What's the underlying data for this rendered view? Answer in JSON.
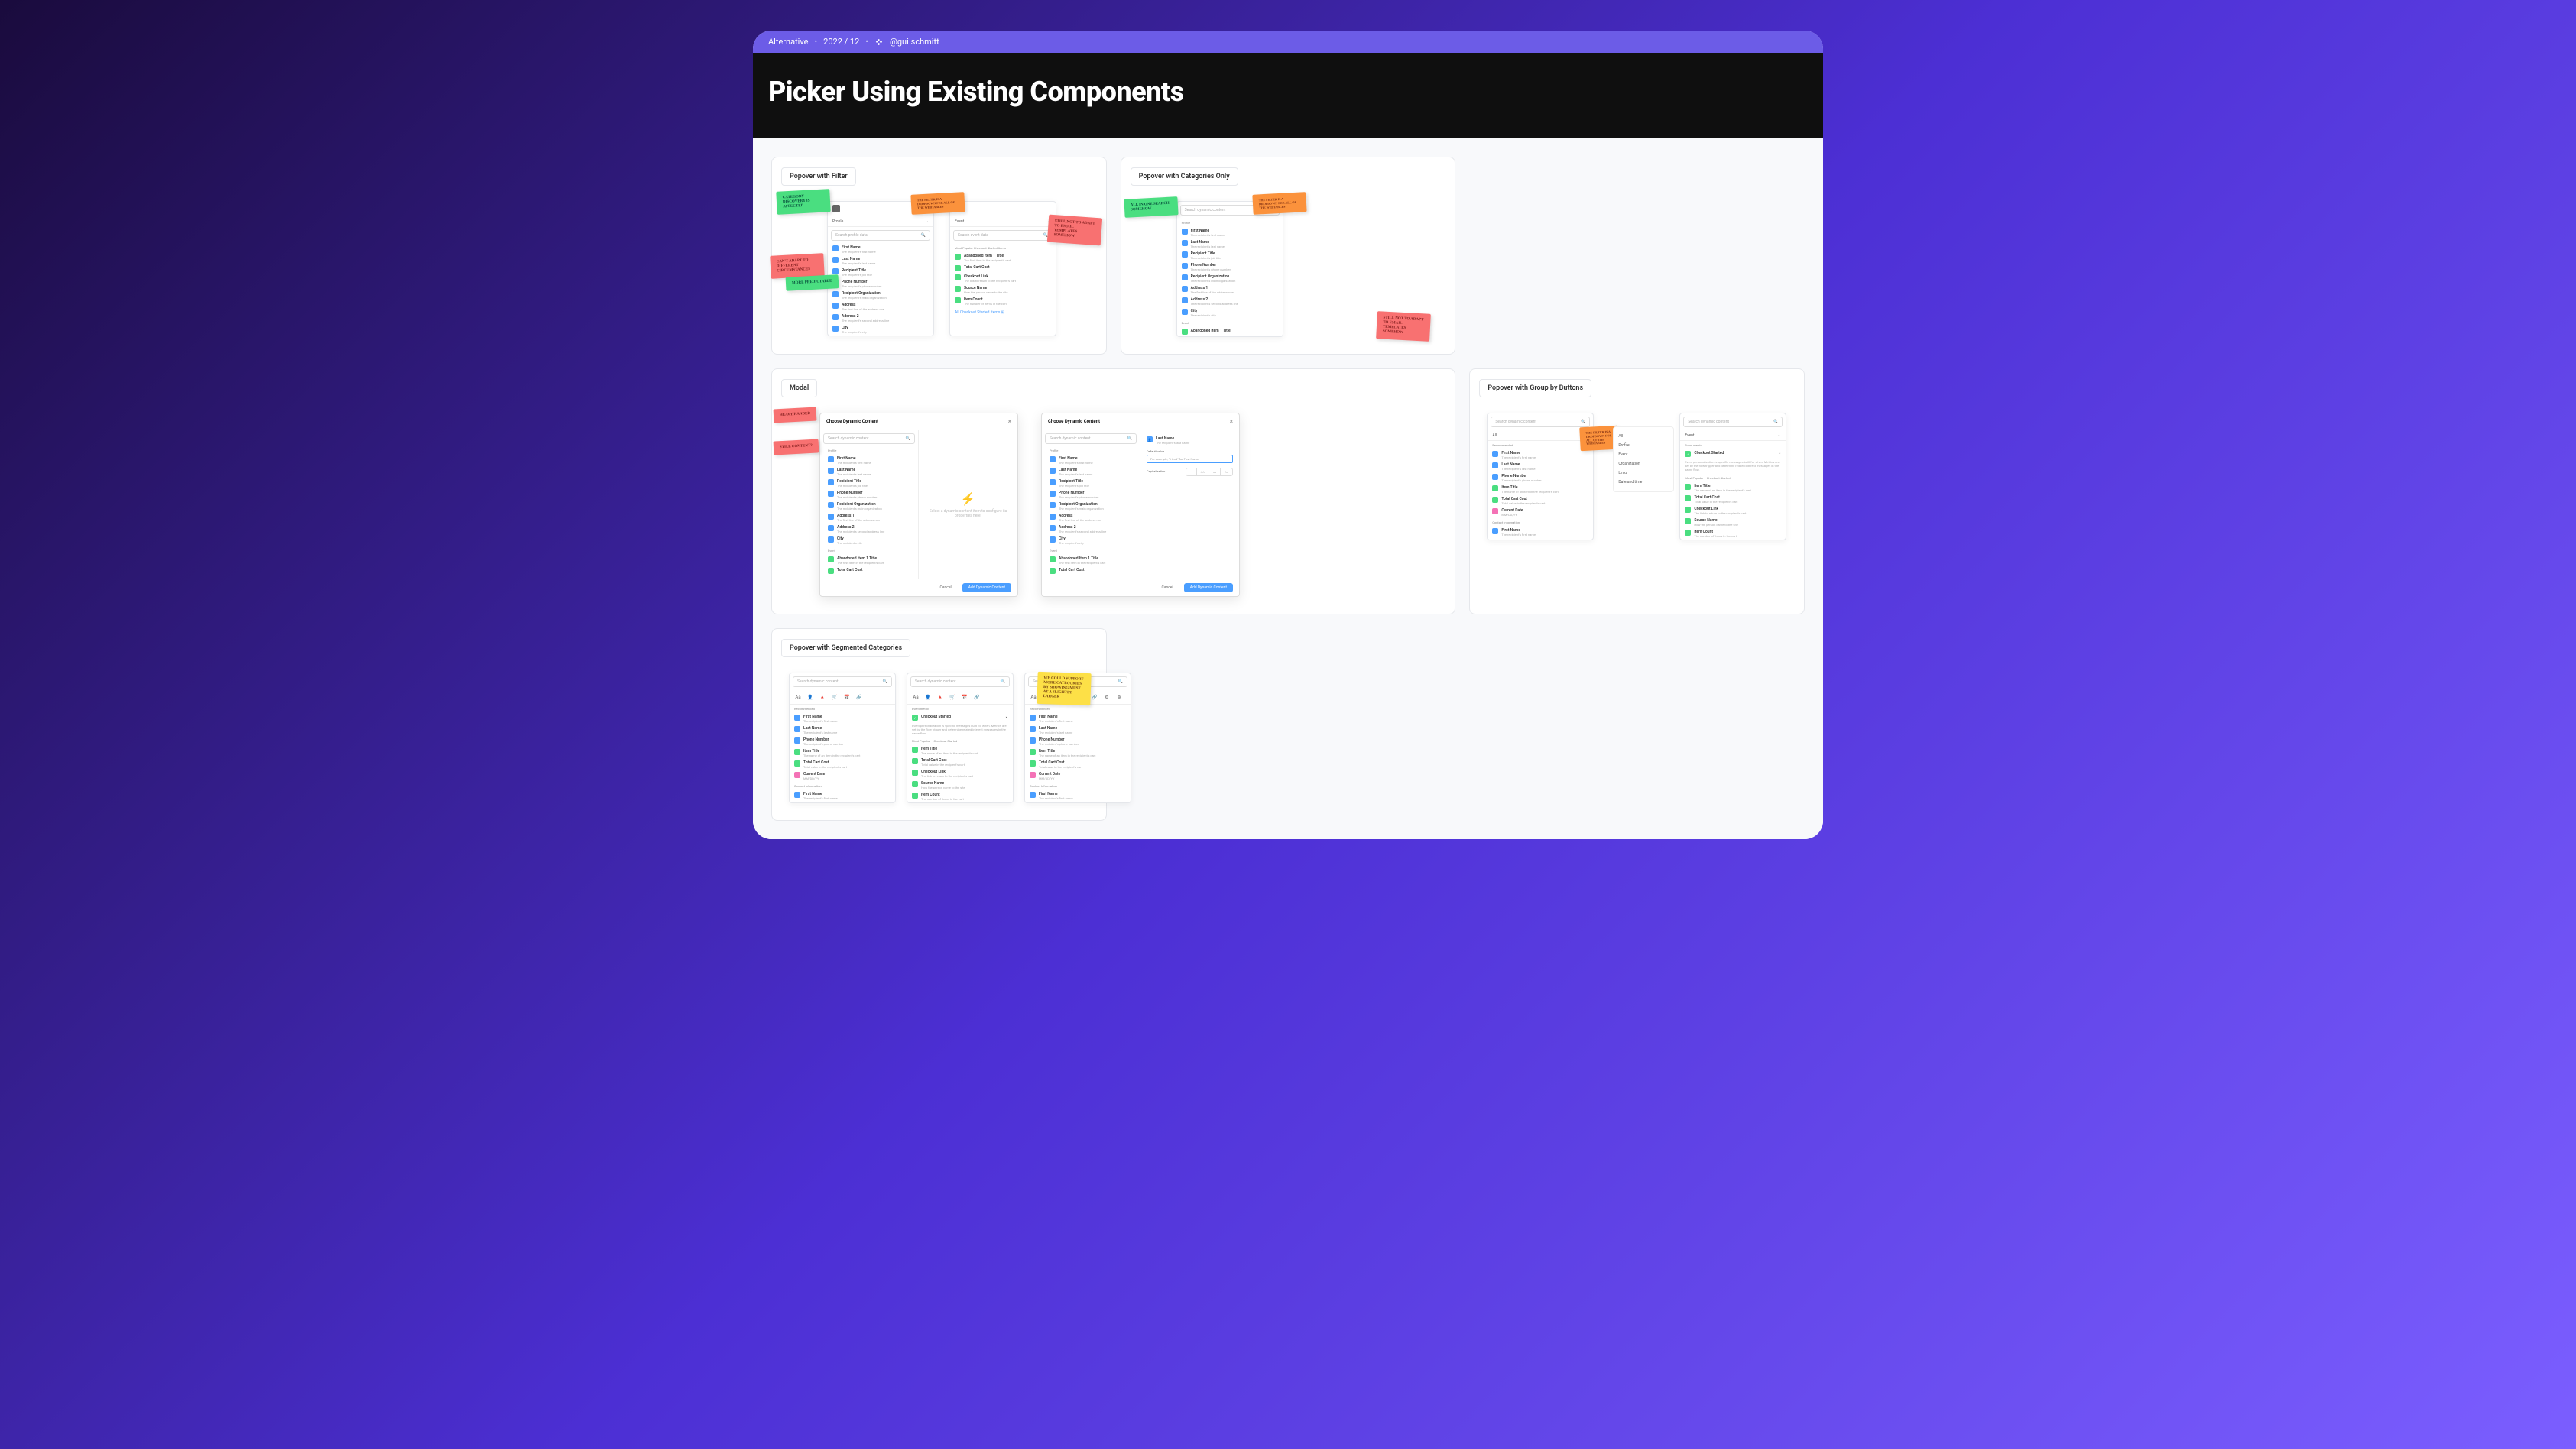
{
  "topbar": {
    "label": "Alternative",
    "date": "2022 / 12",
    "handle": "@gui.schmitt"
  },
  "hero": {
    "title": "Picker Using Existing Components"
  },
  "cards": {
    "popover_filter": {
      "title": "Popover with Filter"
    },
    "popover_categories": {
      "title": "Popover with Categories Only"
    },
    "modal": {
      "title": "Modal"
    },
    "popover_groupbtn": {
      "title": "Popover with Group by Buttons"
    },
    "popover_segmented": {
      "title": "Popover with Segmented Categories"
    }
  },
  "stickies": {
    "category_discovery": "Category discovery is affected",
    "cant_adapt": "Can't adapt to different circumstances",
    "more_predictable": "More predictable",
    "still_not_adapt": "Still not to adapt to Email Templates somehow",
    "all_one_search": "All in one search somehow",
    "filter_dropdown": "the filter is a dropdown for all of the webtables",
    "heavy_handed": "Heavy handed",
    "still_content": "Still content?",
    "support_more": "We could support more categories by showing must at a slightly larger"
  },
  "dropdown_profile": {
    "tab": "Profile",
    "search": "Search profile data",
    "items": [
      {
        "name": "First Name",
        "sub": "The recipient's first name",
        "ic": "blue"
      },
      {
        "name": "Last Name",
        "sub": "The recipient's last name",
        "ic": "blue"
      },
      {
        "name": "Recipient Title",
        "sub": "The recipient's job title",
        "ic": "blue"
      },
      {
        "name": "Phone Number",
        "sub": "The recipient's phone number",
        "ic": "blue"
      },
      {
        "name": "Recipient Organization",
        "sub": "The recipient's main organization",
        "ic": "blue"
      },
      {
        "name": "Address 1",
        "sub": "The first line of the address row",
        "ic": "blue"
      },
      {
        "name": "Address 2",
        "sub": "The recipient's second address line",
        "ic": "blue"
      },
      {
        "name": "City",
        "sub": "The recipient's city",
        "ic": "blue"
      }
    ]
  },
  "dropdown_event": {
    "tab": "Event",
    "search": "Search event data",
    "section": "Most Popular Checkout Started Items",
    "items": [
      {
        "name": "Abandoned Item 1 Title",
        "sub": "The first item in the recipient's cart",
        "ic": "green"
      },
      {
        "name": "Total Cart Cost",
        "sub": "",
        "ic": "green"
      },
      {
        "name": "Checkout Link",
        "sub": "The link to return to the recipient's cart",
        "ic": "green"
      },
      {
        "name": "Source Name",
        "sub": "How the person came to the site",
        "ic": "green"
      },
      {
        "name": "Item Count",
        "sub": "The number of items in the cart",
        "ic": "green"
      }
    ],
    "footer": "All Checkout Started Items"
  },
  "dropdown_full": {
    "search": "Search dynamic content",
    "sections": [
      {
        "label": "Profile",
        "items": [
          {
            "name": "First Name",
            "sub": "The recipient's first name",
            "ic": "blue"
          },
          {
            "name": "Last Name",
            "sub": "The recipient's last name",
            "ic": "blue"
          },
          {
            "name": "Recipient Title",
            "sub": "The recipient's job title",
            "ic": "blue"
          },
          {
            "name": "Phone Number",
            "sub": "The recipient's phone number",
            "ic": "blue"
          },
          {
            "name": "Recipient Organization",
            "sub": "The recipient's main organization",
            "ic": "blue"
          },
          {
            "name": "Address 1",
            "sub": "The first line of the address row",
            "ic": "blue"
          },
          {
            "name": "Address 2",
            "sub": "The recipient's second address line",
            "ic": "blue"
          },
          {
            "name": "City",
            "sub": "The recipient's city",
            "ic": "blue"
          }
        ]
      },
      {
        "label": "Event",
        "items": [
          {
            "name": "Abandoned Item 1 Title",
            "sub": "",
            "ic": "green"
          }
        ]
      }
    ]
  },
  "modal_mock": {
    "title": "Choose Dynamic Content",
    "search": "Search dynamic content",
    "empty": "Select a dynamic content item to configure its properties here.",
    "cancel": "Cancel",
    "add": "Add Dynamic Content",
    "sections": [
      {
        "label": "Profile",
        "items": [
          {
            "name": "First Name",
            "sub": "The recipient's first name",
            "ic": "blue"
          },
          {
            "name": "Last Name",
            "sub": "The recipient's last name",
            "ic": "blue"
          },
          {
            "name": "Recipient Title",
            "sub": "The recipient's job title",
            "ic": "blue"
          },
          {
            "name": "Phone Number",
            "sub": "The recipient's phone number",
            "ic": "blue"
          },
          {
            "name": "Recipient Organization",
            "sub": "The recipient's main organization",
            "ic": "blue"
          },
          {
            "name": "Address 1",
            "sub": "The first line of the address row",
            "ic": "blue"
          },
          {
            "name": "Address 2",
            "sub": "The recipient's second address line",
            "ic": "blue"
          },
          {
            "name": "City",
            "sub": "The recipient's city",
            "ic": "blue"
          }
        ]
      },
      {
        "label": "Event",
        "items": [
          {
            "name": "Abandoned Item 1 Title",
            "sub": "The first item in the recipient's cart",
            "ic": "green"
          },
          {
            "name": "Total Cart Cost",
            "sub": "",
            "ic": "green"
          }
        ]
      }
    ],
    "config": {
      "selected": {
        "name": "Last Name",
        "sub": "The recipient's last name"
      },
      "default_label": "Default value",
      "default_ph": "For example, \"friend\" for First Name",
      "cap_label": "Capitalization",
      "cap_opts": [
        "—",
        "AA",
        "aa",
        "Aa"
      ]
    }
  },
  "groupbtn": {
    "search": "Search dynamic content",
    "side": {
      "opts": [
        "All",
        "Profile",
        "Event",
        "Organization",
        "Links",
        "Date and time"
      ]
    },
    "side_note": "The filter is a dropdown for all of the webtables",
    "rec_label": "Recommended",
    "rec": [
      {
        "name": "First Name",
        "sub": "The recipient's first name",
        "ic": "blue"
      },
      {
        "name": "Last Name",
        "sub": "The recipient's last name",
        "ic": "blue"
      },
      {
        "name": "Phone Number",
        "sub": "The recipient's phone number",
        "ic": "blue"
      },
      {
        "name": "Item Title",
        "sub": "The name of an item in the recipient's cart",
        "ic": "green"
      },
      {
        "name": "Total Cart Cost",
        "sub": "Total value in the recipient's cart",
        "ic": "green"
      },
      {
        "name": "Current Date",
        "sub": "MM/DD/YY",
        "ic": "pink"
      }
    ],
    "contact_label": "Contact Information",
    "contact": [
      {
        "name": "First Name",
        "sub": "The recipient's first name",
        "ic": "blue"
      }
    ],
    "event_label": "Event metric",
    "event_sel": "Checkout Started",
    "event_desc": "Event personalization is specific messages built for when. Metrics are set by the flow trigger and determine related interest messages in the same flow.",
    "most_pop": "Most Popular – Checkout Started",
    "event_items": [
      {
        "name": "Item Title",
        "sub": "The name of an item in the recipient's cart",
        "ic": "green"
      },
      {
        "name": "Total Cart Cost",
        "sub": "Total value in the recipient's cart",
        "ic": "green"
      },
      {
        "name": "Checkout Link",
        "sub": "The link to return to the recipient's cart",
        "ic": "green"
      },
      {
        "name": "Source Name",
        "sub": "How the person came to the site",
        "ic": "green"
      },
      {
        "name": "Item Count",
        "sub": "The number of items in the cart",
        "ic": "green"
      }
    ]
  },
  "segmented": {
    "icons": [
      "Aa",
      "👤",
      "🔺",
      "🛒",
      "📅",
      "🔗"
    ]
  }
}
